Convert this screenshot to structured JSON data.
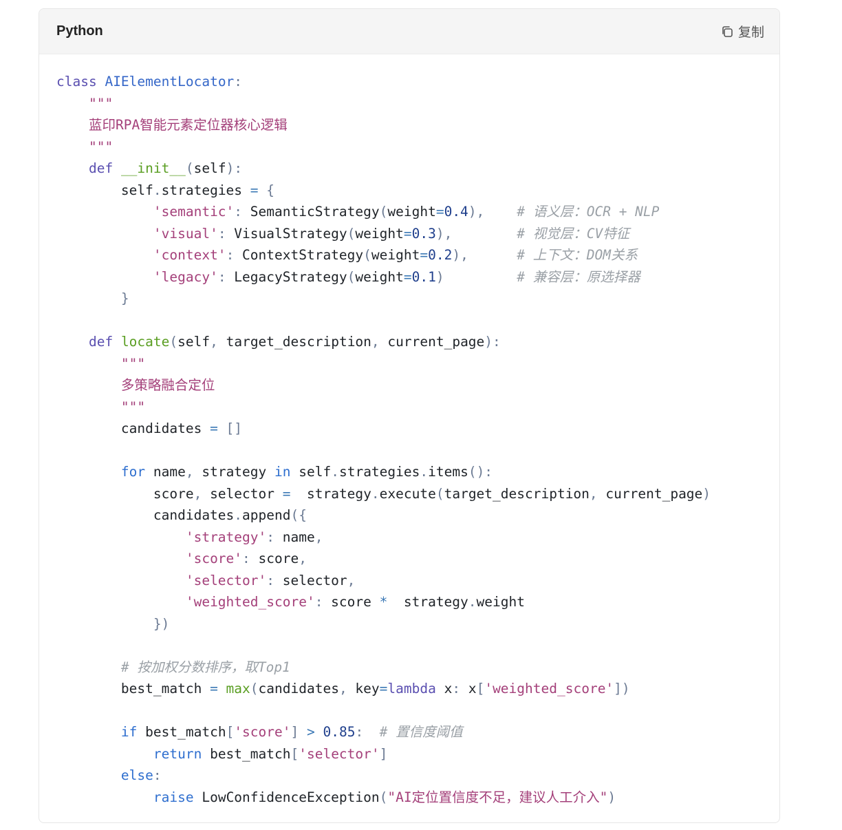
{
  "header": {
    "language": "Python",
    "copy_label": "复制",
    "copy_icon": "copy-icon"
  },
  "code_lines": [
    [
      [
        "kw",
        "class "
      ],
      [
        "cls",
        "AIElementLocator"
      ],
      [
        "pn",
        ":"
      ]
    ],
    [
      [
        "",
        "    "
      ],
      [
        "doc",
        "\"\"\""
      ]
    ],
    [
      [
        "",
        "    "
      ],
      [
        "doc",
        "蓝印RPA智能元素定位器核心逻辑"
      ]
    ],
    [
      [
        "",
        "    "
      ],
      [
        "doc",
        "\"\"\""
      ]
    ],
    [
      [
        "",
        "    "
      ],
      [
        "kw",
        "def "
      ],
      [
        "fn",
        "__init__"
      ],
      [
        "pn",
        "("
      ],
      [
        "",
        "self"
      ],
      [
        "pn",
        "):"
      ]
    ],
    [
      [
        "",
        "        self"
      ],
      [
        "pn",
        "."
      ],
      [
        "",
        "strategies "
      ],
      [
        "op",
        "="
      ],
      [
        "pn",
        " {"
      ]
    ],
    [
      [
        "",
        "            "
      ],
      [
        "str",
        "'semantic'"
      ],
      [
        "pn",
        ": "
      ],
      [
        "",
        "SemanticStrategy"
      ],
      [
        "pn",
        "("
      ],
      [
        "",
        "weight"
      ],
      [
        "op",
        "="
      ],
      [
        "num",
        "0.4"
      ],
      [
        "pn",
        "),"
      ],
      [
        "",
        "    "
      ],
      [
        "cm",
        "# 语义层：OCR + NLP"
      ]
    ],
    [
      [
        "",
        "            "
      ],
      [
        "str",
        "'visual'"
      ],
      [
        "pn",
        ": "
      ],
      [
        "",
        "VisualStrategy"
      ],
      [
        "pn",
        "("
      ],
      [
        "",
        "weight"
      ],
      [
        "op",
        "="
      ],
      [
        "num",
        "0.3"
      ],
      [
        "pn",
        "),"
      ],
      [
        "",
        "        "
      ],
      [
        "cm",
        "# 视觉层：CV特征"
      ]
    ],
    [
      [
        "",
        "            "
      ],
      [
        "str",
        "'context'"
      ],
      [
        "pn",
        ": "
      ],
      [
        "",
        "ContextStrategy"
      ],
      [
        "pn",
        "("
      ],
      [
        "",
        "weight"
      ],
      [
        "op",
        "="
      ],
      [
        "num",
        "0.2"
      ],
      [
        "pn",
        "),"
      ],
      [
        "",
        "      "
      ],
      [
        "cm",
        "# 上下文：DOM关系"
      ]
    ],
    [
      [
        "",
        "            "
      ],
      [
        "str",
        "'legacy'"
      ],
      [
        "pn",
        ": "
      ],
      [
        "",
        "LegacyStrategy"
      ],
      [
        "pn",
        "("
      ],
      [
        "",
        "weight"
      ],
      [
        "op",
        "="
      ],
      [
        "num",
        "0.1"
      ],
      [
        "pn",
        ")"
      ],
      [
        "",
        "         "
      ],
      [
        "cm",
        "# 兼容层：原选择器"
      ]
    ],
    [
      [
        "",
        "        "
      ],
      [
        "pn",
        "}"
      ]
    ],
    [],
    [
      [
        "",
        "    "
      ],
      [
        "kw",
        "def "
      ],
      [
        "fn",
        "locate"
      ],
      [
        "pn",
        "("
      ],
      [
        "",
        "self"
      ],
      [
        "pn",
        ", "
      ],
      [
        "",
        "target_description"
      ],
      [
        "pn",
        ", "
      ],
      [
        "",
        "current_page"
      ],
      [
        "pn",
        "):"
      ]
    ],
    [
      [
        "",
        "        "
      ],
      [
        "doc",
        "\"\"\""
      ]
    ],
    [
      [
        "",
        "        "
      ],
      [
        "doc",
        "多策略融合定位"
      ]
    ],
    [
      [
        "",
        "        "
      ],
      [
        "doc",
        "\"\"\""
      ]
    ],
    [
      [
        "",
        "        candidates "
      ],
      [
        "op",
        "="
      ],
      [
        "pn",
        " []"
      ]
    ],
    [],
    [
      [
        "",
        "        "
      ],
      [
        "kw2",
        "for "
      ],
      [
        "",
        "name"
      ],
      [
        "pn",
        ", "
      ],
      [
        "",
        "strategy "
      ],
      [
        "kw2",
        "in "
      ],
      [
        "",
        "self"
      ],
      [
        "pn",
        "."
      ],
      [
        "",
        "strategies"
      ],
      [
        "pn",
        "."
      ],
      [
        "",
        "items"
      ],
      [
        "pn",
        "():"
      ]
    ],
    [
      [
        "",
        "            score"
      ],
      [
        "pn",
        ", "
      ],
      [
        "",
        "selector "
      ],
      [
        "op",
        "="
      ],
      [
        "",
        ""
      ],
      [
        "",
        "  strategy"
      ],
      [
        "pn",
        "."
      ],
      [
        "",
        "execute"
      ],
      [
        "pn",
        "("
      ],
      [
        "",
        "target_description"
      ],
      [
        "pn",
        ", "
      ],
      [
        "",
        "current_page"
      ],
      [
        "pn",
        ")"
      ]
    ],
    [
      [
        "",
        "            candidates"
      ],
      [
        "pn",
        "."
      ],
      [
        "",
        "append"
      ],
      [
        "pn",
        "({"
      ]
    ],
    [
      [
        "",
        "                "
      ],
      [
        "str",
        "'strategy'"
      ],
      [
        "pn",
        ": "
      ],
      [
        "",
        "name"
      ],
      [
        "pn",
        ","
      ]
    ],
    [
      [
        "",
        "                "
      ],
      [
        "str",
        "'score'"
      ],
      [
        "pn",
        ": "
      ],
      [
        "",
        "score"
      ],
      [
        "pn",
        ","
      ]
    ],
    [
      [
        "",
        "                "
      ],
      [
        "str",
        "'selector'"
      ],
      [
        "pn",
        ": "
      ],
      [
        "",
        "selector"
      ],
      [
        "pn",
        ","
      ]
    ],
    [
      [
        "",
        "                "
      ],
      [
        "str",
        "'weighted_score'"
      ],
      [
        "pn",
        ": "
      ],
      [
        "",
        "score "
      ],
      [
        "op",
        "*"
      ],
      [
        "",
        ""
      ],
      [
        "",
        "  strategy"
      ],
      [
        "pn",
        "."
      ],
      [
        "",
        "weight"
      ]
    ],
    [
      [
        "",
        "            "
      ],
      [
        "pn",
        "})"
      ]
    ],
    [],
    [
      [
        "",
        "        "
      ],
      [
        "cm",
        "# 按加权分数排序，取Top1"
      ]
    ],
    [
      [
        "",
        "        best_match "
      ],
      [
        "op",
        "="
      ],
      [
        "",
        ""
      ],
      [
        "builtin",
        " max"
      ],
      [
        "pn",
        "("
      ],
      [
        "",
        "candidates"
      ],
      [
        "pn",
        ", "
      ],
      [
        "",
        "key"
      ],
      [
        "op",
        "="
      ],
      [
        "kw",
        "lambda "
      ],
      [
        "",
        "x"
      ],
      [
        "pn",
        ": "
      ],
      [
        "",
        "x"
      ],
      [
        "pn",
        "["
      ],
      [
        "str",
        "'weighted_score'"
      ],
      [
        "pn",
        "])"
      ]
    ],
    [],
    [
      [
        "",
        "        "
      ],
      [
        "kw2",
        "if "
      ],
      [
        "",
        "best_match"
      ],
      [
        "pn",
        "["
      ],
      [
        "str",
        "'score'"
      ],
      [
        "pn",
        "] "
      ],
      [
        "op",
        "> "
      ],
      [
        "num",
        "0.85"
      ],
      [
        "pn",
        ":  "
      ],
      [
        "cm",
        "# 置信度阈值"
      ]
    ],
    [
      [
        "",
        "            "
      ],
      [
        "kw2",
        "return "
      ],
      [
        "",
        "best_match"
      ],
      [
        "pn",
        "["
      ],
      [
        "str",
        "'selector'"
      ],
      [
        "pn",
        "]"
      ]
    ],
    [
      [
        "",
        "        "
      ],
      [
        "kw2",
        "else"
      ],
      [
        "pn",
        ":"
      ]
    ],
    [
      [
        "",
        "            "
      ],
      [
        "kw2",
        "raise "
      ],
      [
        "",
        "LowConfidenceException"
      ],
      [
        "pn",
        "("
      ],
      [
        "str",
        "\"AI定位置信度不足，建议人工介入\""
      ],
      [
        "pn",
        ")"
      ]
    ]
  ]
}
